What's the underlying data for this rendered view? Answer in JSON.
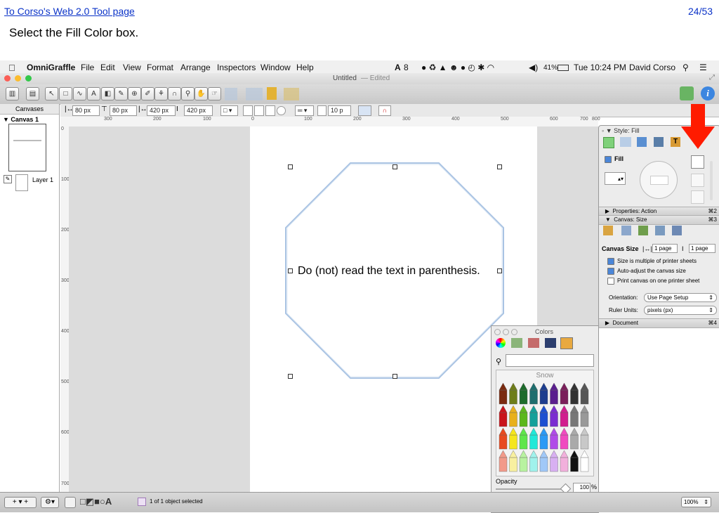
{
  "slide": {
    "link_text": "To Corso's Web 2.0 Tool page",
    "page_number": "24/53",
    "instruction": "Select the Fill Color box."
  },
  "menubar": {
    "app_name": "OmniGraffle",
    "items": [
      "File",
      "Edit",
      "View",
      "Format",
      "Arrange",
      "Inspectors",
      "Window",
      "Help"
    ],
    "status_count": "8",
    "battery": "41%",
    "clock": "Tue 10:24 PM",
    "user": "David Corso"
  },
  "window": {
    "title": "Untitled",
    "edited": "— Edited"
  },
  "inspector_bar": {
    "x": "80 px",
    "y": "80 px",
    "w": "420 px",
    "h": "420 px",
    "stroke": "10 p"
  },
  "sidebar": {
    "header": "Canvases",
    "canvas": "Canvas 1",
    "layer": "Layer 1"
  },
  "ruler": {
    "h_ticks": [
      "300",
      "200",
      "100",
      "0",
      "100",
      "200",
      "300",
      "400",
      "500",
      "600",
      "700",
      "800"
    ],
    "v_ticks": [
      "0",
      "100",
      "200",
      "300",
      "400",
      "500",
      "600",
      "700"
    ]
  },
  "shape": {
    "text": "Do (not) read the text in parenthesis."
  },
  "style_inspector": {
    "title": "Style: Fill",
    "fill_label": "Fill",
    "properties_label": "Properties: Action",
    "properties_shortcut": "⌘2",
    "canvas_label": "Canvas: Size",
    "canvas_shortcut": "⌘3",
    "canvas_size_label": "Canvas Size",
    "width_pages": "1 page",
    "height_pages": "1 page",
    "opt_multiple": "Size is multiple of printer sheets",
    "opt_autoadjust": "Auto-adjust the canvas size",
    "opt_print_one": "Print canvas on one printer sheet",
    "orientation_label": "Orientation:",
    "orientation_value": "Use Page Setup",
    "units_label": "Ruler Units:",
    "units_value": "pixels (px)",
    "document_label": "Document",
    "document_shortcut": "⌘4"
  },
  "colors_panel": {
    "title": "Colors",
    "crayon_name": "Snow",
    "opacity_label": "Opacity",
    "opacity_value": "100",
    "opacity_unit": "%"
  },
  "statusbar": {
    "selection": "1 of 1 object selected",
    "zoom": "100%"
  },
  "colors": {
    "arrow": "#ff1b00",
    "shape_stroke": "#a9c3e3"
  }
}
